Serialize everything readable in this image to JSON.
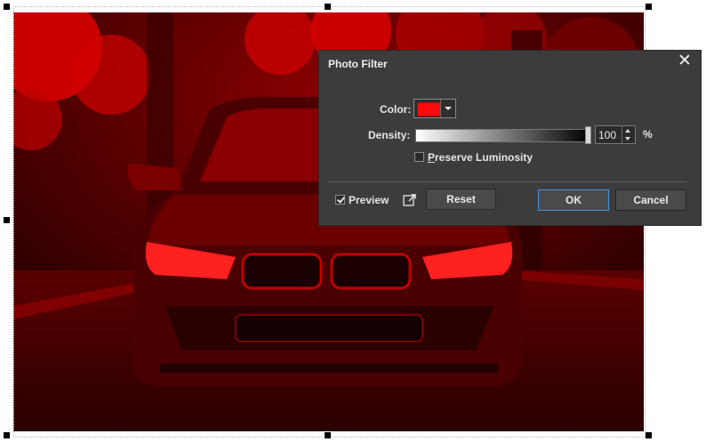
{
  "dialog": {
    "title": "Photo Filter",
    "color_label": "Color:",
    "color_value": "#ff0a0a",
    "density_label": "Density:",
    "density_value": "100",
    "density_unit": "%",
    "preserve_luminosity_label": "Preserve Luminosity",
    "preserve_luminosity_checked": false,
    "preview_label": "Preview",
    "preview_checked": true,
    "reset_label": "Reset",
    "ok_label": "OK",
    "cancel_label": "Cancel"
  },
  "icons": {
    "close": "close-icon",
    "open_external": "open-external-icon",
    "dropdown": "chevron-down-icon"
  },
  "colors": {
    "dialog_bg": "#3c3c3c",
    "filter_tint": "#ff0000",
    "ok_border": "#4a90d9"
  }
}
